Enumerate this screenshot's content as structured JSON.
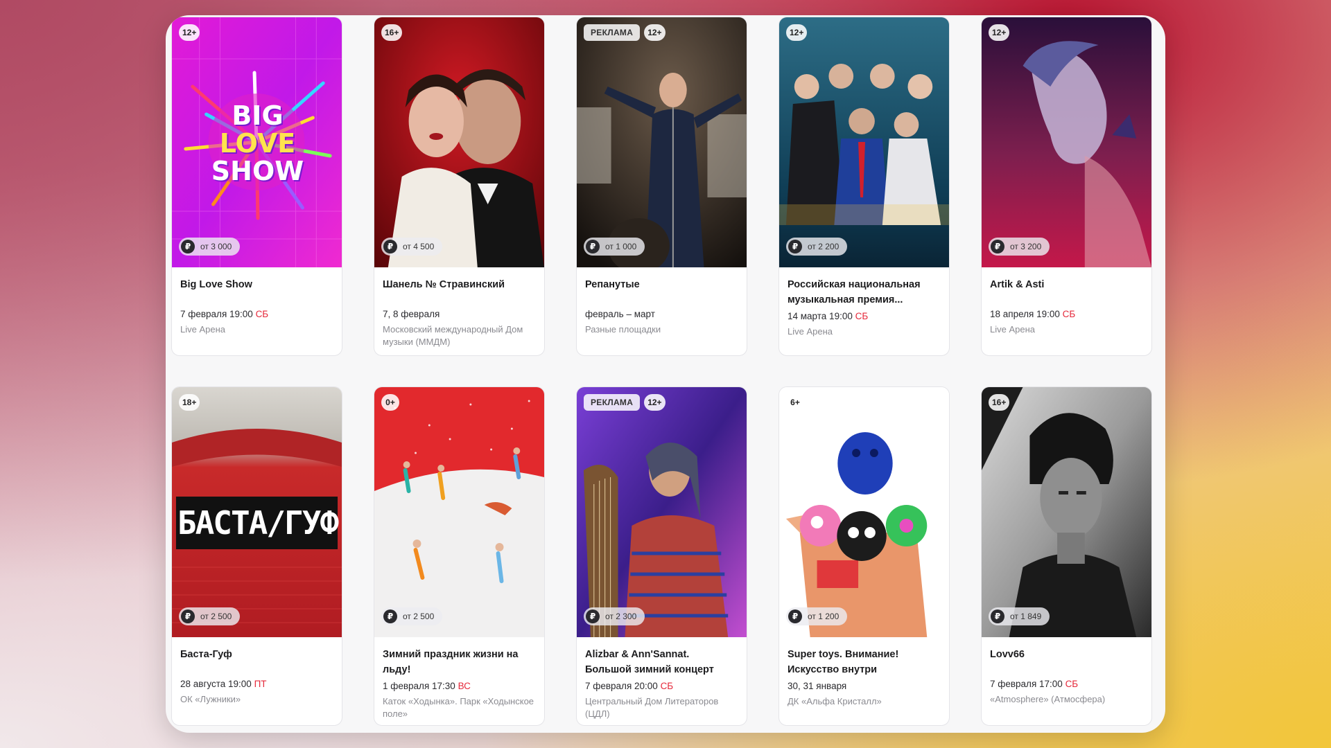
{
  "events": [
    {
      "age": "12+",
      "ad": "",
      "price": "от 3 000",
      "title": "Big Love Show",
      "date": "7 февраля 19:00",
      "day": "СБ",
      "venue": "Live Арена",
      "poster_text": "BIG LOVE SHOW"
    },
    {
      "age": "16+",
      "ad": "",
      "price": "от 4 500",
      "title": "Шанель № Стравинский",
      "date": "7, 8 февраля",
      "day": "",
      "venue": "Московский международный Дом музыки (ММДМ)",
      "poster_text": ""
    },
    {
      "age": "12+",
      "ad": "РЕКЛАМА",
      "price": "от 1 000",
      "title": "Репанутые",
      "date": "февраль – март",
      "day": "",
      "venue": "Разные площадки",
      "poster_text": ""
    },
    {
      "age": "12+",
      "ad": "",
      "price": "от 2 200",
      "title": "Российская национальная музыкальная премия...",
      "date": "14 марта 19:00",
      "day": "СБ",
      "venue": "Live Арена",
      "poster_text": ""
    },
    {
      "age": "12+",
      "ad": "",
      "price": "от 3 200",
      "title": "Artik & Asti",
      "date": "18 апреля 19:00",
      "day": "СБ",
      "venue": "Live Арена",
      "poster_text": ""
    },
    {
      "age": "18+",
      "ad": "",
      "price": "от 2 500",
      "title": "Баста-Гуф",
      "date": "28 августа 19:00",
      "day": "ПТ",
      "venue": "ОК «Лужники»",
      "poster_text": "БАСТА/ГУФ"
    },
    {
      "age": "0+",
      "ad": "",
      "price": "от 2 500",
      "title": "Зимний праздник жизни на льду!",
      "date": "1 февраля 17:30",
      "day": "ВС",
      "venue": "Каток «Ходынка». Парк «Ходынское поле»",
      "poster_text": ""
    },
    {
      "age": "12+",
      "ad": "РЕКЛАМА",
      "price": "от 2 300",
      "title": "Alizbar & Ann'Sannat. Большой зимний концерт",
      "date": "7 февраля 20:00",
      "day": "СБ",
      "venue": "Центральный Дом Литераторов (ЦДЛ)",
      "poster_text": ""
    },
    {
      "age": "6+",
      "ad": "",
      "price": "от 1 200",
      "title": "Super toys. Внимание! Искусство внутри",
      "date": "30, 31 января",
      "day": "",
      "venue": "ДК «Альфа Кристалл»",
      "poster_text": ""
    },
    {
      "age": "16+",
      "ad": "",
      "price": "от 1 849",
      "title": "Lovv66",
      "date": "7 февраля 17:00",
      "day": "СБ",
      "venue": "«Atmosphere» (Атмосфера)",
      "poster_text": ""
    }
  ],
  "currency_symbol": "₽",
  "colors": {
    "accent_day": "#e5283a",
    "title": "#1c1c1e",
    "venue": "#8a8a90"
  }
}
